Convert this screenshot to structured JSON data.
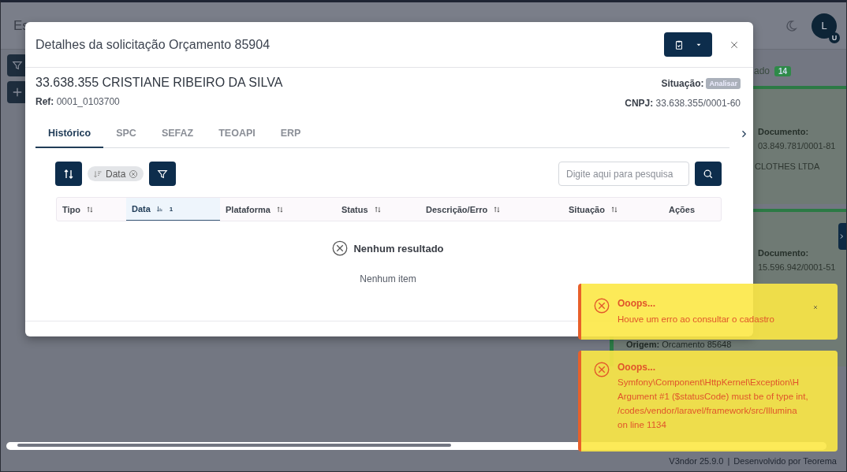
{
  "app": {
    "title": "Es",
    "avatar": {
      "initial": "L",
      "badge": "U"
    }
  },
  "background_column": {
    "heading": "ado",
    "count": "14",
    "cards": [
      {
        "label": "Documento:",
        "value": "03.849.781/0001-81",
        "company": "CLOTHES LTDA"
      },
      {
        "label": "Documento:",
        "value": "15.596.942/0001-51"
      }
    ],
    "origin_label": "Origem:",
    "origin_value": "Orcamento 85648"
  },
  "modal": {
    "title": "Detalhes da solicitação Orçamento 85904",
    "client": "33.638.355 CRISTIANE RIBEIRO DA SILVA",
    "ref_label": "Ref:",
    "ref": "0001_0103700",
    "status_label": "Situação:",
    "status": "Analisar",
    "cnpj_label": "CNPJ:",
    "cnpj": "33.638.355/0001-60",
    "tabs": [
      {
        "label": "Histórico",
        "selected": true
      },
      {
        "label": "SPC",
        "selected": false
      },
      {
        "label": "SEFAZ",
        "selected": false
      },
      {
        "label": "TEOAPI",
        "selected": false
      },
      {
        "label": "ERP",
        "selected": false
      }
    ],
    "sort_chip": "Data",
    "search": {
      "placeholder": "Digite aqui para pesquisa"
    },
    "columns": [
      {
        "label": "Tipo",
        "sortable": true,
        "selected": false
      },
      {
        "label": "Data",
        "sortable": true,
        "selected": true,
        "sort_order": "1"
      },
      {
        "label": "Plataforma",
        "sortable": true,
        "selected": false
      },
      {
        "label": "Status",
        "sortable": true,
        "selected": false
      },
      {
        "label": "Descrição/Erro",
        "sortable": true,
        "selected": false
      },
      {
        "label": "Situação",
        "sortable": true,
        "selected": false
      },
      {
        "label": "Ações",
        "sortable": false,
        "selected": false
      }
    ],
    "empty_title": "Nenhum resultado",
    "empty_text": "Nenhum item"
  },
  "toasts": [
    {
      "title": "Ooops...",
      "lines": [
        "Houve um erro ao consultar o cadastro"
      ],
      "closable": true
    },
    {
      "title": "Ooops...",
      "lines": [
        "Symfony\\Component\\HttpKernel\\Exception\\H",
        "Argument #1 ($statusCode) must be of type int,",
        "/codes/vendor/laravel/framework/src/Illumina",
        "on line 1134"
      ],
      "closable": false
    }
  ],
  "footer": {
    "version": "V3ndor  25.9.0",
    "separator": "|",
    "credit": "Desenvolvido por Teorema"
  }
}
